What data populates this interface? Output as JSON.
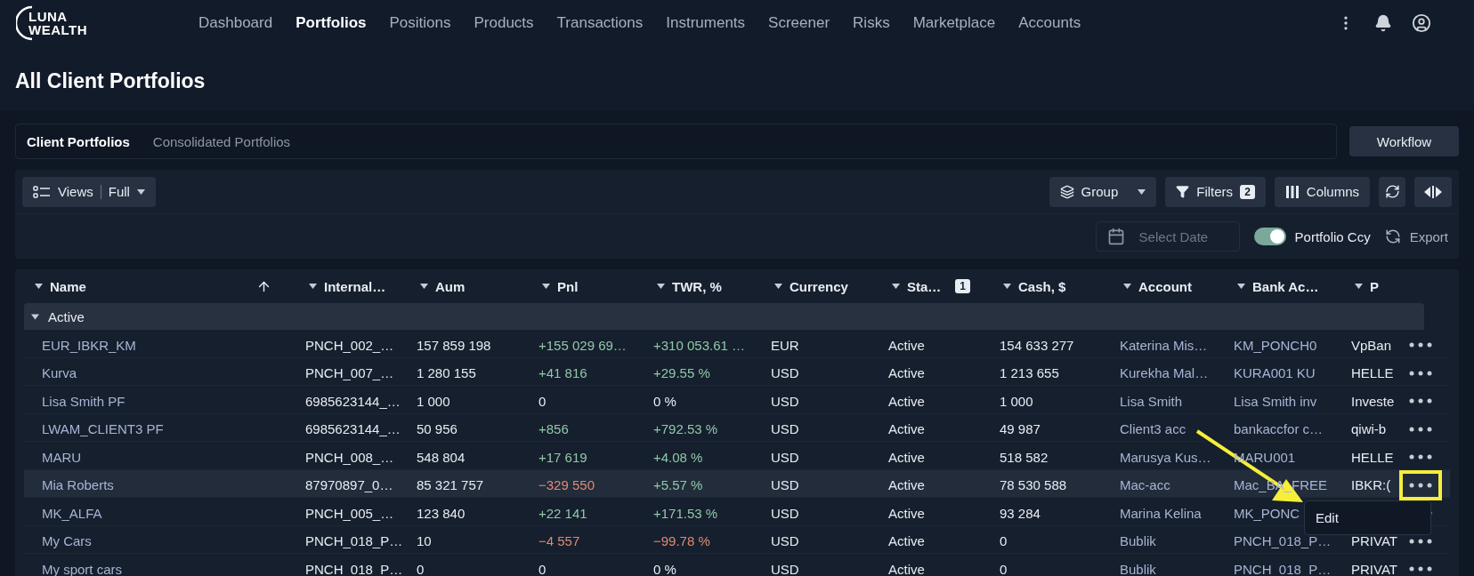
{
  "logo": {
    "lines": [
      "LUNA",
      "WEALTH"
    ]
  },
  "nav": [
    {
      "label": "Dashboard",
      "selected": false
    },
    {
      "label": "Portfolios",
      "selected": true
    },
    {
      "label": "Positions",
      "selected": false
    },
    {
      "label": "Products",
      "selected": false
    },
    {
      "label": "Transactions",
      "selected": false
    },
    {
      "label": "Instruments",
      "selected": false
    },
    {
      "label": "Screener",
      "selected": false
    },
    {
      "label": "Risks",
      "selected": false
    },
    {
      "label": "Marketplace",
      "selected": false
    },
    {
      "label": "Accounts",
      "selected": false
    }
  ],
  "page_title": "All Client Portfolios",
  "tabs": [
    {
      "label": "Client Portfolios",
      "selected": true
    },
    {
      "label": "Consolidated Portfolios",
      "selected": false
    }
  ],
  "workflow_button": "Workflow",
  "toolbar": {
    "views_label": "Views",
    "views_value": "Full",
    "group": "Group",
    "filters": "Filters",
    "filters_count": "2",
    "columns": "Columns",
    "date_placeholder": "Select Date",
    "ccy_toggle": {
      "label": "Portfolio Ccy",
      "on": true
    },
    "export": "Export"
  },
  "table": {
    "columns": [
      {
        "label": "Name",
        "sorted": true
      },
      {
        "label": "Internal…",
        "sorted": false
      },
      {
        "label": "Aum",
        "sorted": false
      },
      {
        "label": "Pnl",
        "sorted": false
      },
      {
        "label": "TWR, %",
        "sorted": false
      },
      {
        "label": "Currency",
        "sorted": false
      },
      {
        "label": "Sta…",
        "sorted": false,
        "badge": "1"
      },
      {
        "label": "Cash, $",
        "sorted": false
      },
      {
        "label": "Account",
        "sorted": false
      },
      {
        "label": "Bank Ac…",
        "sorted": false
      },
      {
        "label": "P",
        "sorted": false
      }
    ],
    "group": {
      "label": "Active",
      "expanded": true
    },
    "rows": [
      {
        "cells": [
          {
            "text": "EUR_IBKR_KM"
          },
          {
            "text": "PNCH_002_…"
          },
          {
            "text": "157 859 198"
          },
          {
            "text": "+155 029 69…",
            "color": "#8fc9a9"
          },
          {
            "text": "+310 053.61 …",
            "color": "#8fc9a9"
          },
          {
            "text": "EUR"
          },
          {
            "text": "Active"
          },
          {
            "text": "154 633 277"
          },
          {
            "text": "Katerina Mis…"
          },
          {
            "text": "KM_PONCH0"
          },
          {
            "text": "VpBan"
          }
        ],
        "selected": false,
        "menu_open": false
      },
      {
        "cells": [
          {
            "text": "Kurva"
          },
          {
            "text": "PNCH_007_…"
          },
          {
            "text": "1 280 155"
          },
          {
            "text": "+41 816",
            "color": "#8fc9a9"
          },
          {
            "text": "+29.55 %",
            "color": "#8fc9a9"
          },
          {
            "text": "USD"
          },
          {
            "text": "Active"
          },
          {
            "text": "1 213 655"
          },
          {
            "text": "Kurekha Mal…"
          },
          {
            "text": "KURA001  KU"
          },
          {
            "text": "HELLE"
          }
        ],
        "selected": false,
        "menu_open": false
      },
      {
        "cells": [
          {
            "text": "Lisa Smith PF"
          },
          {
            "text": "6985623144_…"
          },
          {
            "text": "1 000"
          },
          {
            "text": "0",
            "color": "#e8ecf3"
          },
          {
            "text": "0 %",
            "color": "#e8ecf3"
          },
          {
            "text": "USD"
          },
          {
            "text": "Active"
          },
          {
            "text": "1 000"
          },
          {
            "text": "Lisa Smith"
          },
          {
            "text": "Lisa Smith inv"
          },
          {
            "text": "Investe"
          }
        ],
        "selected": false,
        "menu_open": false
      },
      {
        "cells": [
          {
            "text": "LWAM_CLIENT3 PF"
          },
          {
            "text": "6985623144_…"
          },
          {
            "text": "50 956"
          },
          {
            "text": "+856",
            "color": "#8fc9a9"
          },
          {
            "text": "+792.53 %",
            "color": "#8fc9a9"
          },
          {
            "text": "USD"
          },
          {
            "text": "Active"
          },
          {
            "text": "49 987"
          },
          {
            "text": "Client3 acc"
          },
          {
            "text": "bankaccfor c…"
          },
          {
            "text": "qiwi-b"
          }
        ],
        "selected": false,
        "menu_open": false
      },
      {
        "cells": [
          {
            "text": "MARU"
          },
          {
            "text": "PNCH_008_…"
          },
          {
            "text": "548 804"
          },
          {
            "text": "+17 619",
            "color": "#8fc9a9"
          },
          {
            "text": "+4.08 %",
            "color": "#8fc9a9"
          },
          {
            "text": "USD"
          },
          {
            "text": "Active"
          },
          {
            "text": "518 582"
          },
          {
            "text": "Marusya Kus…"
          },
          {
            "text": "MARU001"
          },
          {
            "text": "HELLE"
          }
        ],
        "selected": false,
        "menu_open": false
      },
      {
        "cells": [
          {
            "text": "Mia Roberts"
          },
          {
            "text": "87970897_0…"
          },
          {
            "text": "85 321 757"
          },
          {
            "text": "−329 550",
            "color": "#e08a70"
          },
          {
            "text": "+5.57 %",
            "color": "#8fc9a9"
          },
          {
            "text": "USD"
          },
          {
            "text": "Active"
          },
          {
            "text": "78 530 588"
          },
          {
            "text": "Mac-acc"
          },
          {
            "text": "Mac_BA_FREE"
          },
          {
            "text": "IBKR:("
          }
        ],
        "selected": true,
        "menu_open": true
      },
      {
        "cells": [
          {
            "text": "MK_ALFA"
          },
          {
            "text": "PNCH_005_…"
          },
          {
            "text": "123 840"
          },
          {
            "text": "+22 141",
            "color": "#8fc9a9"
          },
          {
            "text": "+171.53 %",
            "color": "#8fc9a9"
          },
          {
            "text": "USD"
          },
          {
            "text": "Active"
          },
          {
            "text": "93 284"
          },
          {
            "text": "Marina Kelina"
          },
          {
            "text": "MK_PONC"
          }
        ],
        "selected": false,
        "menu_open": false
      },
      {
        "cells": [
          {
            "text": "My Cars"
          },
          {
            "text": "PNCH_018_P…"
          },
          {
            "text": "10"
          },
          {
            "text": "−4 557",
            "color": "#e08a70"
          },
          {
            "text": "−99.78 %",
            "color": "#e08a70"
          },
          {
            "text": "USD"
          },
          {
            "text": "Active"
          },
          {
            "text": "0"
          },
          {
            "text": "Bublik"
          },
          {
            "text": "PNCH_018_P…"
          },
          {
            "text": "PRIVAT"
          }
        ],
        "selected": false,
        "menu_open": false
      },
      {
        "cells": [
          {
            "text": "My sport cars"
          },
          {
            "text": "PNCH_018_P…"
          },
          {
            "text": "0"
          },
          {
            "text": "0",
            "color": "#e8ecf3"
          },
          {
            "text": "0 %",
            "color": "#e8ecf3"
          },
          {
            "text": "USD"
          },
          {
            "text": "Active"
          },
          {
            "text": "0"
          },
          {
            "text": "Bublik"
          },
          {
            "text": "PNCH_018_P…"
          },
          {
            "text": "PRIVAT"
          }
        ],
        "selected": false,
        "menu_open": false
      }
    ],
    "row_menu": [
      "Edit"
    ]
  }
}
